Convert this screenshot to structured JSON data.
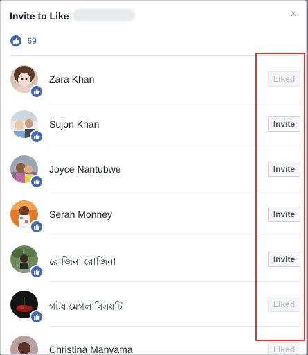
{
  "dialog": {
    "title": "Invite to Like",
    "close_glyph": "×",
    "like_count": "69"
  },
  "rows": [
    {
      "name": "Zara Khan",
      "action": "Liked"
    },
    {
      "name": "Sujon Khan",
      "action": "Invite"
    },
    {
      "name": "Joyce Nantubwe",
      "action": "Invite"
    },
    {
      "name": "Serah Monney",
      "action": "Invite"
    },
    {
      "name": "রোজিনা রোজিনা",
      "action": "Invite"
    },
    {
      "name": "গটষ মেগলাবিসষটি",
      "action": "Liked"
    },
    {
      "name": "Christina Manyama",
      "action": "Liked"
    }
  ],
  "colors": {
    "brand_blue": "#4267b2",
    "highlight_red": "#e0302f"
  },
  "icons": {
    "like_badge": "thumbs-up-icon",
    "close": "close-icon"
  }
}
